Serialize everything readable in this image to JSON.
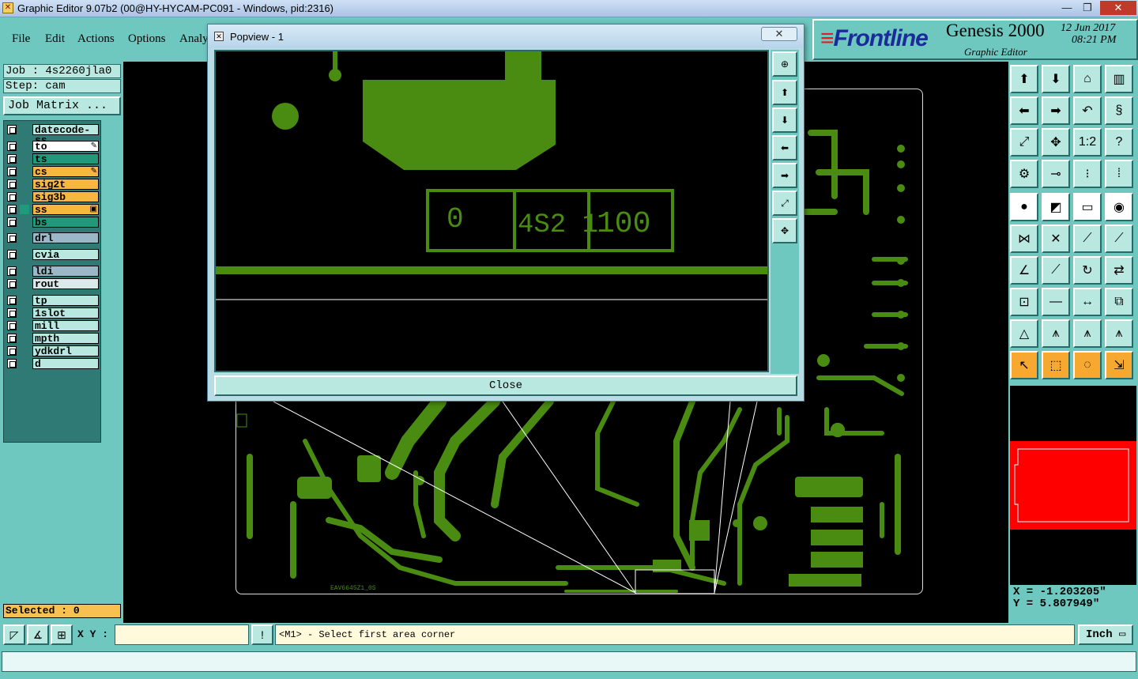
{
  "window": {
    "title": "Graphic Editor 9.07b2 (00@HY-HYCAM-PC091 - Windows, pid:2316)",
    "minimize": "—",
    "maximize": "❐",
    "close": "✕"
  },
  "menubar": {
    "file": "File",
    "edit": "Edit",
    "actions": "Actions",
    "options": "Options",
    "analysis": "Analy"
  },
  "logo": {
    "brand": "Frontline",
    "product": "Genesis 2000",
    "subtitle": "Graphic Editor",
    "date": "12 Jun 2017",
    "time": "08:21 PM"
  },
  "job": {
    "job_label": "Job : 4s2260jla0",
    "step_label": "Step: cam",
    "matrix_button": "Job Matrix ..."
  },
  "layers": [
    {
      "name": "datecode-ss",
      "color": "#b8e8e0",
      "marker": ""
    },
    {
      "name": "to",
      "color": "#ffffff",
      "marker": "✎"
    },
    {
      "name": "ts",
      "color": "#1f9a7a",
      "marker": ""
    },
    {
      "name": "cs",
      "color": "#f7b640",
      "marker": "✎"
    },
    {
      "name": "sig2t",
      "color": "#f7b640",
      "marker": ""
    },
    {
      "name": "sig3b",
      "color": "#f7b640",
      "marker": ""
    },
    {
      "name": "ss",
      "color": "#f7b640",
      "marker": "▣"
    },
    {
      "name": "bs",
      "color": "#1f9a7a",
      "marker": ""
    },
    {
      "name": "drl",
      "color": "#9ab8c8",
      "marker": ""
    },
    {
      "name": "cvia",
      "color": "#b8e8e0",
      "marker": ""
    },
    {
      "name": "ldi",
      "color": "#9ab8c8",
      "marker": ""
    },
    {
      "name": "rout",
      "color": "#dde8ea",
      "marker": ""
    },
    {
      "name": "tp",
      "color": "#b8e8e0",
      "marker": ""
    },
    {
      "name": "1slot",
      "color": "#b8e8e0",
      "marker": ""
    },
    {
      "name": "mill",
      "color": "#b8e8e0",
      "marker": ""
    },
    {
      "name": "mpth",
      "color": "#b8e8e0",
      "marker": ""
    },
    {
      "name": "ydkdrl",
      "color": "#b8e8e0",
      "marker": ""
    },
    {
      "name": "d",
      "color": "#b8e8e0",
      "marker": ""
    }
  ],
  "selected": "Selected : 0",
  "popup": {
    "title": "Popview - 1",
    "close_x": "✕",
    "close_button": "Close",
    "digits_left": "0",
    "digits_mid": "4S2 1",
    "digits_right": "100"
  },
  "board": {
    "silkscreen_text": "EAV6645Z1_0S"
  },
  "coords": {
    "x": "X = -1.203205\"",
    "y": "Y = 5.807949\""
  },
  "bottom": {
    "xy_label": "X Y :",
    "xy_value": "",
    "bang": "!",
    "prompt": "<M1> - Select first area corner",
    "unit": "Inch"
  },
  "colors": {
    "trace": "#4a8c12",
    "panel": "#6ec8c0",
    "selected_layer": "#f7b640"
  }
}
